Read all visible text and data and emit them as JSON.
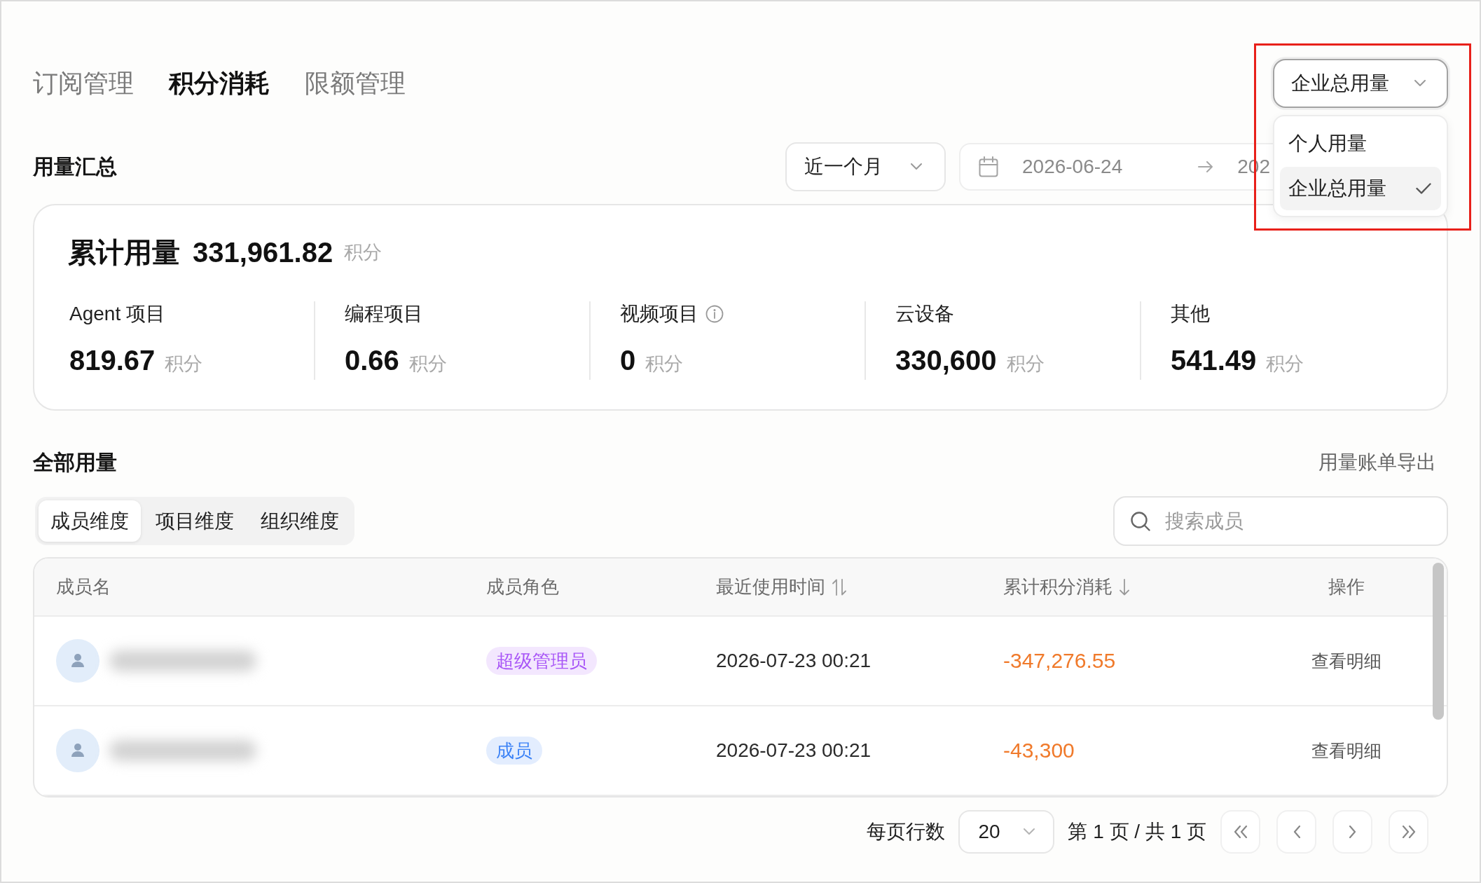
{
  "tabs": [
    {
      "label": "订阅管理",
      "selected": false
    },
    {
      "label": "积分消耗",
      "selected": true
    },
    {
      "label": "限额管理",
      "selected": false
    }
  ],
  "scope_select": {
    "value": "企业总用量",
    "expanded": true,
    "options": [
      {
        "label": "个人用量",
        "selected": false
      },
      {
        "label": "企业总用量",
        "selected": true
      }
    ]
  },
  "summary": {
    "title": "用量汇总",
    "period_select": {
      "value": "近一个月"
    },
    "date_range": {
      "start": "2026-06-24",
      "end": "202"
    },
    "total": {
      "label": "累计用量",
      "value": "331,961.82",
      "unit": "积分"
    },
    "categories": [
      {
        "label": "Agent 项目",
        "info": false,
        "value": "819.67",
        "unit": "积分"
      },
      {
        "label": "编程项目",
        "info": false,
        "value": "0.66",
        "unit": "积分"
      },
      {
        "label": "视频项目",
        "info": true,
        "value": "0",
        "unit": "积分"
      },
      {
        "label": "云设备",
        "info": false,
        "value": "330,600",
        "unit": "积分"
      },
      {
        "label": "其他",
        "info": false,
        "value": "541.49",
        "unit": "积分"
      }
    ]
  },
  "usage": {
    "title": "全部用量",
    "export_link": "用量账单导出",
    "views": [
      {
        "label": "成员维度",
        "selected": true
      },
      {
        "label": "项目维度",
        "selected": false
      },
      {
        "label": "组织维度",
        "selected": false
      }
    ],
    "search": {
      "placeholder": "搜索成员"
    },
    "table": {
      "columns": [
        {
          "label": "成员名",
          "kind": "plain"
        },
        {
          "label": "成员角色",
          "kind": "plain"
        },
        {
          "label": "最近使用时间",
          "kind": "sortable"
        },
        {
          "label": "累计积分消耗",
          "kind": "sorted"
        },
        {
          "label": "操作",
          "kind": "plain"
        }
      ],
      "rows": [
        {
          "role": {
            "label": "超级管理员",
            "color": "#a855f7"
          },
          "last_used": "2026-07-23 00:21",
          "points": "-347,276.55",
          "action": "查看明细"
        },
        {
          "role": {
            "label": "成员",
            "color": "#3b82f6"
          },
          "last_used": "2026-07-23 00:21",
          "points": "-43,300",
          "action": "查看明细"
        }
      ]
    }
  },
  "pagination": {
    "rows_label": "每页行数",
    "page_size": "20",
    "page_info": "第 1 页 / 共 1 页"
  }
}
